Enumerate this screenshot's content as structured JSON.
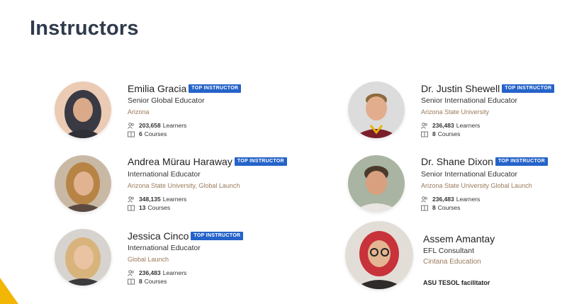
{
  "title": "Instructors",
  "badge_text": "TOP INSTRUCTOR",
  "learners_suffix": "Learners",
  "courses_suffix": "Courses",
  "instructors": [
    {
      "name": "Emilia Gracia",
      "role": "Senior Global Educator",
      "org": "Arizona",
      "learners": "203,658",
      "courses": "6"
    },
    {
      "name": "Andrea Mürau Haraway",
      "role": "International Educator",
      "org": "Arizona State University, Global Launch",
      "learners": "348,135",
      "courses": "13"
    },
    {
      "name": "Jessica Cinco",
      "role": "International Educator",
      "org": "Global Launch",
      "learners": "236,483",
      "courses": "8"
    },
    {
      "name": "Dr. Justin Shewell",
      "role": "Senior International Educator",
      "org": "Arizona State University",
      "learners": "236,483",
      "courses": "8"
    },
    {
      "name": "Dr. Shane Dixon",
      "role": "Senior International Educator",
      "org": "Arizona State University Global Launch",
      "learners": "236,483",
      "courses": "8"
    }
  ],
  "extra_instructor": {
    "name": "Assem Amantay",
    "role": "EFL Consultant",
    "org": "Cintana Education",
    "note": "ASU TESOL facilitator"
  },
  "colors": {
    "title": "#2f3a4b",
    "badge": "#2563c9",
    "org_text": "#9a7b5a",
    "accent_triangle": "#f2b705"
  },
  "icons": [
    "learners-icon",
    "courses-icon"
  ]
}
